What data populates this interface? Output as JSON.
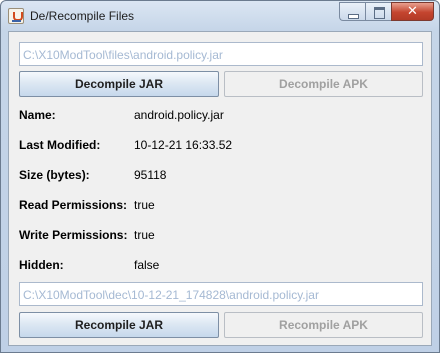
{
  "window": {
    "title": "De/Recompile Files",
    "close_symbol": "✕"
  },
  "source": {
    "path": "C:\\X10ModTool\\files\\android.policy.jar",
    "decompile_jar_label": "Decompile JAR",
    "decompile_apk_label": "Decompile APK"
  },
  "details": [
    {
      "label": "Name:",
      "value": "android.policy.jar"
    },
    {
      "label": "Last Modified:",
      "value": "10-12-21 16:33.52"
    },
    {
      "label": "Size (bytes):",
      "value": "95118"
    },
    {
      "label": "Read Permissions:",
      "value": "true"
    },
    {
      "label": "Write Permissions:",
      "value": "true"
    },
    {
      "label": "Hidden:",
      "value": "false"
    }
  ],
  "output": {
    "path": "C:\\X10ModTool\\dec\\10-12-21_174828\\android.policy.jar",
    "recompile_jar_label": "Recompile JAR",
    "recompile_apk_label": "Recompile APK"
  }
}
